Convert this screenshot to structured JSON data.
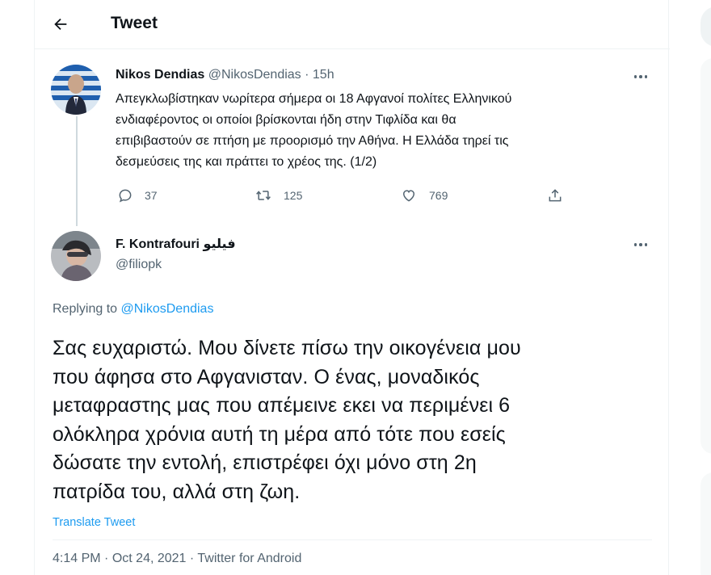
{
  "header": {
    "title": "Tweet",
    "back_icon": "arrow-left-icon"
  },
  "parent_tweet": {
    "author_name": "Nikos Dendias",
    "handle": "@NikosDendias",
    "separator": "·",
    "time": "15h",
    "text_lines": [
      "Απεγκλωβίστηκαν νωρίτερα σήμερα οι 18 Αφγανοί πολίτες Ελληνικού",
      "ενδιαφέροντος οι οποίοι βρίσκονται ήδη στην Τιφλίδα και θα",
      "επιβιβαστούν σε πτήση με προορισμό την Αθήνα. Η Ελλάδα τηρεί τις",
      "δεσμεύσεις της και πράττει το χρέος της. (1/2)"
    ],
    "replies": "37",
    "retweets": "125",
    "likes": "769"
  },
  "main_tweet": {
    "author_name": "F. Kontrafouri فيليو",
    "handle": "@filiopk",
    "replying_prefix": "Replying to",
    "replying_to": "@NikosDendias",
    "text_lines": [
      "Σας ευχαριστώ. Μου δίνετε πίσω την οικογένεια μου",
      "που άφησα στο Αφγανισταν. Ο ένας, μοναδικός",
      "μεταφραστης μας που απέμεινε εκει να περιμένει 6",
      "ολόκληρα χρόνια αυτή τη μέρα από τότε που εσείς",
      "δώσατε την εντολή, επιστρέφει όχι μόνο στη 2η",
      "πατρίδα του, αλλά στη ζωη."
    ],
    "translate_label": "Translate Tweet",
    "time": "4:14 PM",
    "date": "Oct 24, 2021",
    "separator": "·",
    "source": "Twitter for Android"
  },
  "colors": {
    "accent": "#1d9bf0",
    "text": "#0f1419",
    "muted": "#536471",
    "border": "#eff3f4"
  }
}
